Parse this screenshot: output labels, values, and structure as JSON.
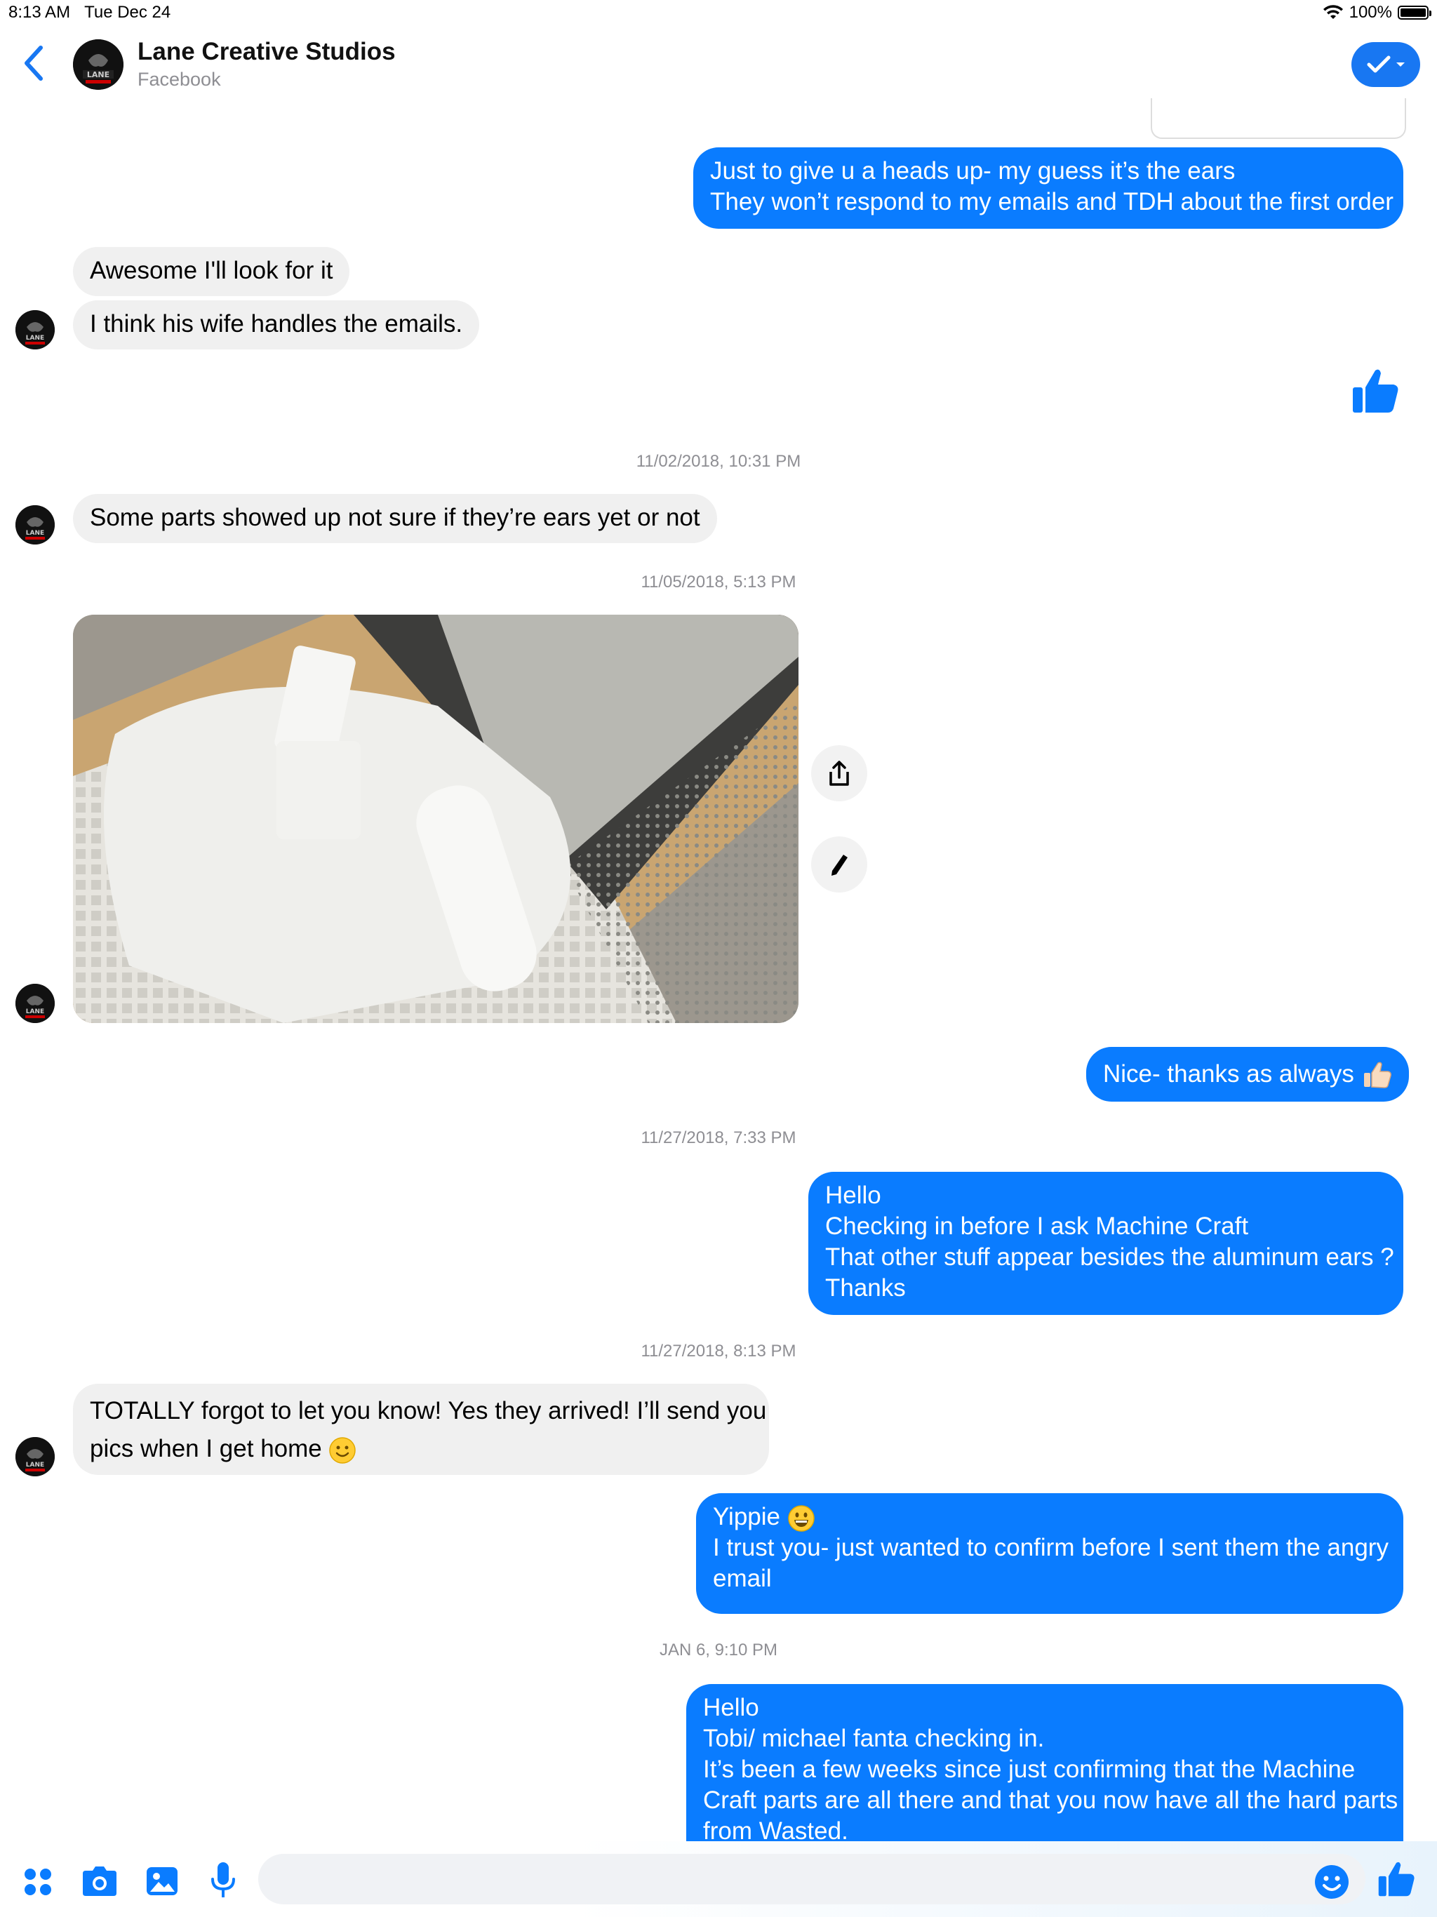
{
  "status": {
    "time": "8:13 AM",
    "date": "Tue Dec 24",
    "battery": "100%",
    "battery_level": 1.0
  },
  "header": {
    "title": "Lane Creative Studios",
    "subtitle": "Facebook"
  },
  "messages": {
    "m1": {
      "line1": "Just to give u a heads up- my guess it’s the ears",
      "line2": "They won’t respond to my emails and TDH about the first order"
    },
    "m2": "Awesome I'll look for it",
    "m3": "I think his wife handles the emails.",
    "ts1": "11/02/2018, 10:31 PM",
    "m4": "Some parts showed up not sure if they’re ears yet or not",
    "ts2": "11/05/2018, 5:13 PM",
    "m5": "Nice- thanks as always",
    "ts3": "11/27/2018, 7:33 PM",
    "m6": {
      "line1": "Hello",
      "line2": "Checking in before I ask Machine Craft",
      "line3": "That other stuff appear besides the aluminum ears ?",
      "line4": "Thanks"
    },
    "ts4": "11/27/2018, 8:13 PM",
    "m7": {
      "line1": "TOTALLY forgot to let you know! Yes they arrived! I’ll send you",
      "line2": "pics when I get home"
    },
    "m8": {
      "line1": "Yippie",
      "line2": "I trust you- just wanted to confirm before I sent them the angry",
      "line3": "email"
    },
    "ts5": "JAN 6, 9:10 PM",
    "m9": {
      "line1": "Hello",
      "line2": "Tobi/ michael fanta checking in.",
      "line3": "It’s been a few weeks since just confirming that the Machine",
      "line4": "Craft parts are all there and that you now have all the hard parts",
      "line5": "from Wasted."
    }
  },
  "icons": [
    "back-chevron-icon",
    "check-icon",
    "thumbs-up-icon",
    "share-icon",
    "pencil-icon",
    "apps-icon",
    "camera-icon",
    "photo-icon",
    "microphone-icon",
    "emoji-icon"
  ],
  "colors": {
    "accent": "#1877f2",
    "outgoing": "#0a7cff",
    "incoming": "#f0f0f0"
  }
}
